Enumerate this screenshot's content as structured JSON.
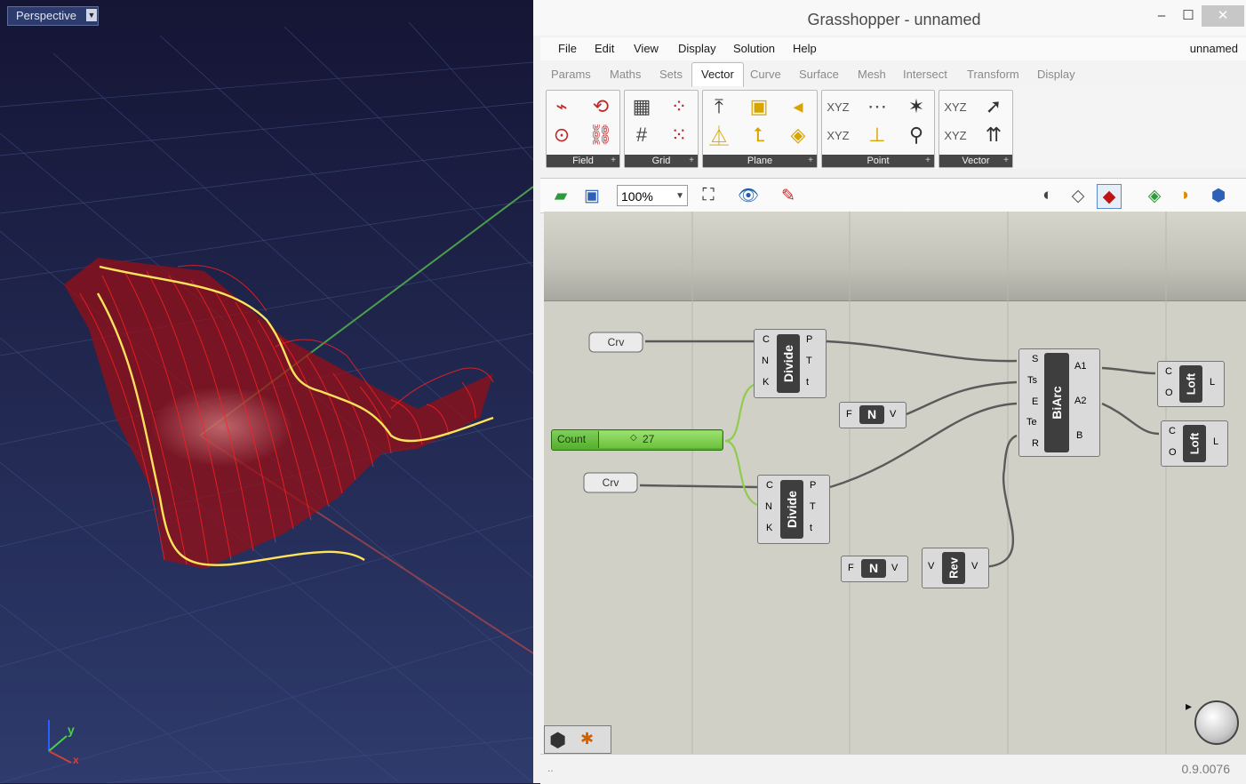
{
  "viewport": {
    "label": "Perspective",
    "dropdown_icon": "triangle-down-icon",
    "axis_y": "y",
    "axis_x": "x"
  },
  "window": {
    "title": "Grasshopper - unnamed",
    "minimize_icon": "minimize-icon",
    "maximize_icon": "maximize-icon",
    "close_icon": "close-icon"
  },
  "menu": {
    "items": [
      "File",
      "Edit",
      "View",
      "Display",
      "Solution",
      "Help"
    ],
    "document_name": "unnamed"
  },
  "tabs": {
    "items": [
      "Params",
      "Maths",
      "Sets",
      "Vector",
      "Curve",
      "Surface",
      "Mesh",
      "Intersect",
      "Transform",
      "Display"
    ],
    "active": "Vector"
  },
  "ribbon": {
    "groups": [
      "Field",
      "Grid",
      "Plane",
      "Point",
      "Vector"
    ]
  },
  "toolbar": {
    "zoom": "100%"
  },
  "canvas": {
    "components": {
      "crv1_label": "Crv",
      "crv2_label": "Crv",
      "divide_title": "Divide",
      "divide_inputs": [
        "C",
        "N",
        "K"
      ],
      "divide_outputs": [
        "P",
        "T",
        "t"
      ],
      "slider_label": "Count",
      "slider_value": "27",
      "unit_f": "F",
      "unit_icon": "N",
      "unit_v": "V",
      "rev_in": "V",
      "rev_title": "Rev",
      "rev_out": "V",
      "biarc_title": "BiArc",
      "biarc_inputs": [
        "S",
        "Ts",
        "E",
        "Te",
        "R"
      ],
      "biarc_outputs": [
        "A1",
        "A2",
        "B"
      ],
      "loft_title": "Loft",
      "loft_inputs": [
        "C",
        "O"
      ],
      "loft_output": "L"
    }
  },
  "status": {
    "version": "0.9.0076",
    "left": ".."
  }
}
